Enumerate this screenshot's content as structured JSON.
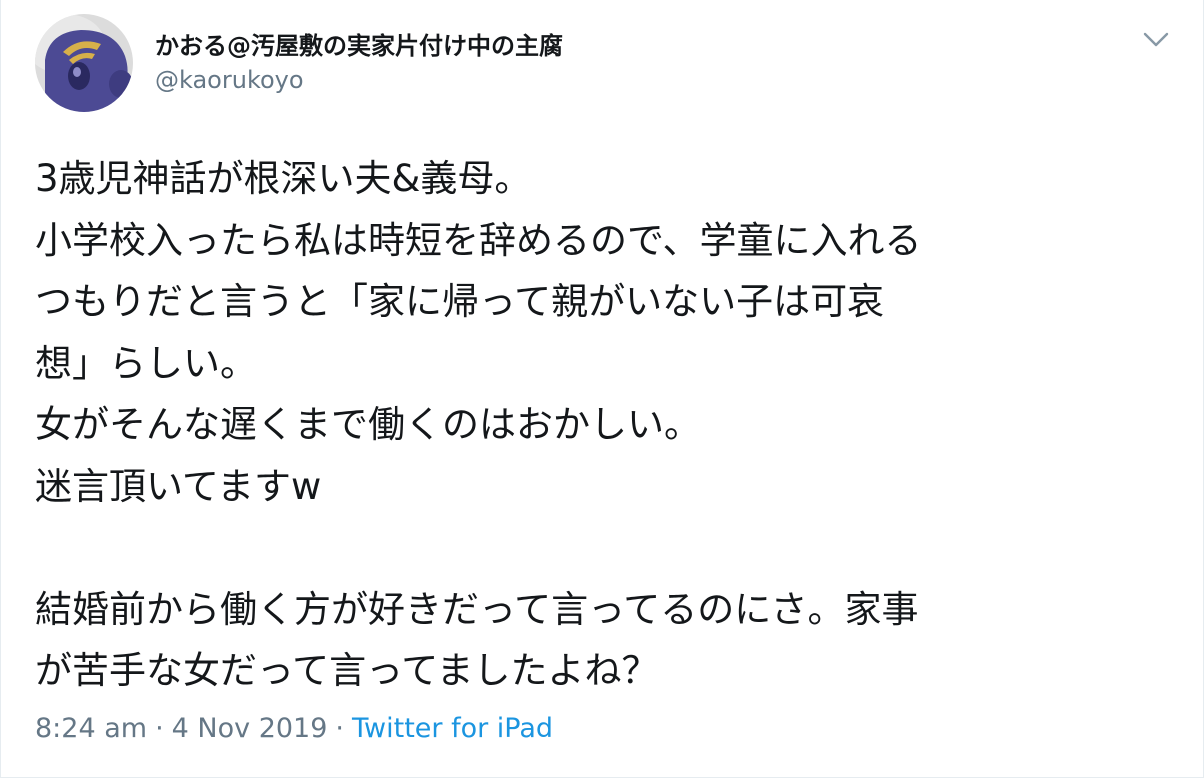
{
  "user": {
    "display_name": "かおる@汚屋敷の実家片付け中の主腐",
    "handle": "@kaorukoyo",
    "avatar_icon": "purple-mascot-avatar"
  },
  "menu": {
    "icon": "chevron-down-icon"
  },
  "tweet": {
    "lines": [
      "3歳児神話が根深い夫&義母。",
      "小学校入ったら私は時短を辞めるので、学童に入れる",
      "つもりだと言うと「家に帰って親がいない子は可哀",
      "想」らしい。",
      "女がそんな遅くまで働くのはおかしい。",
      "迷言頂いてますw",
      "",
      "結婚前から働く方が好きだって言ってるのにさ。家事",
      "が苦手な女だって言ってましたよね？"
    ]
  },
  "meta": {
    "time": "8:24 am",
    "separator": "·",
    "date": "4 Nov 2019",
    "source": "Twitter for iPad"
  },
  "colors": {
    "text_primary": "#14171a",
    "text_secondary": "#657786",
    "link": "#1b95e0",
    "avatar_bg": "#dcdcdc",
    "avatar_figure": "#4c4a94"
  }
}
